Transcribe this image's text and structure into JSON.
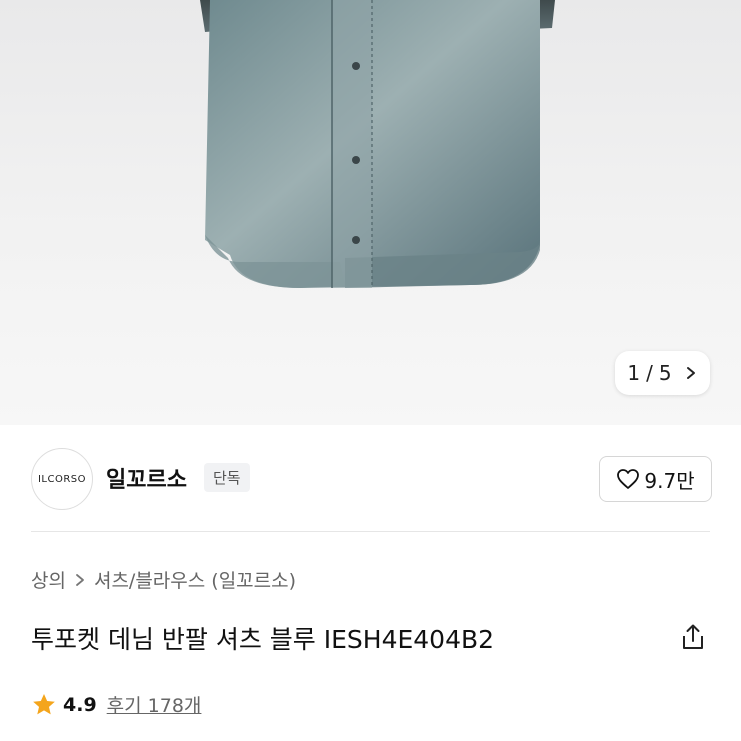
{
  "gallery": {
    "image_alt": "denim short sleeve shirt product photo",
    "counter_current": "1",
    "counter_sep": "/",
    "counter_total": "5"
  },
  "store": {
    "logo_text": "ILCORSO",
    "name": "일꼬르소",
    "badge": "단독",
    "likes": "9.7만"
  },
  "breadcrumb": {
    "items": [
      "상의",
      "셔츠/블라우스 (일꼬르소)"
    ]
  },
  "product": {
    "title": "투포켓 데님 반팔 셔츠 블루 IESH4E404B2"
  },
  "rating": {
    "score": "4.9",
    "reviews": "후기 178개"
  },
  "colors": {
    "star": "#f4a51c",
    "denim": "#5f7a80"
  },
  "icons": [
    "chevron-right-icon",
    "heart-icon",
    "share-icon",
    "star-icon"
  ]
}
